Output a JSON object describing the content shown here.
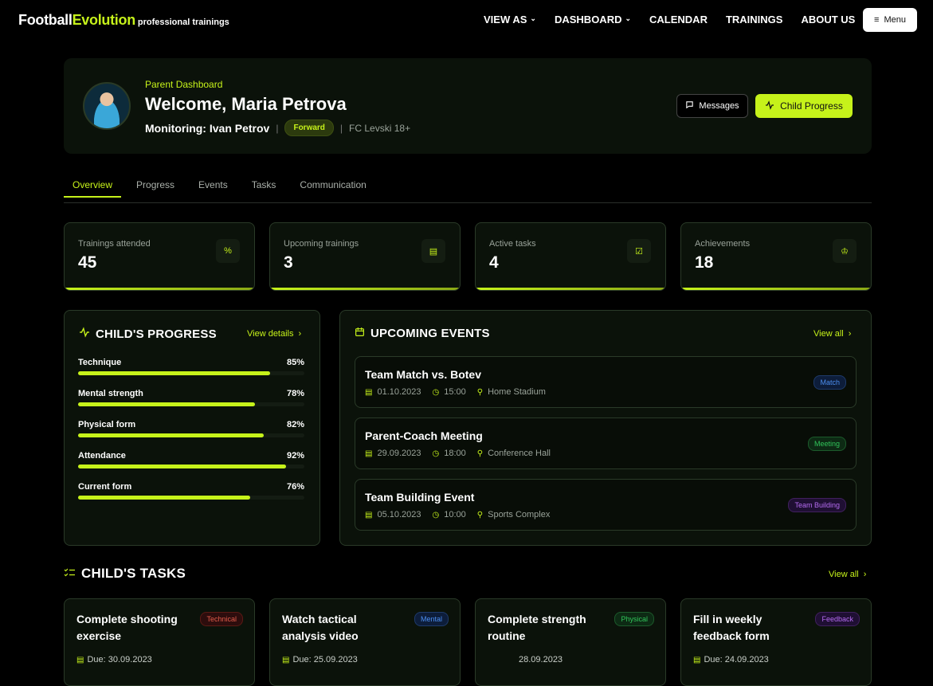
{
  "brand": {
    "part1": "Football",
    "part2": "Evolution",
    "tagline": "professional trainings"
  },
  "nav": {
    "items": [
      "VIEW AS",
      "DASHBOARD",
      "CALENDAR",
      "TRAININGS",
      "ABOUT US"
    ],
    "menu": "Menu"
  },
  "hero": {
    "subtitle": "Parent Dashboard",
    "title": "Welcome, Maria Petrova",
    "monitoring": "Monitoring: Ivan Petrov",
    "position": "Forward",
    "club": "FC Levski 18+",
    "messages_btn": "Messages",
    "progress_btn": "Child Progress"
  },
  "tabs": [
    "Overview",
    "Progress",
    "Events",
    "Tasks",
    "Communication"
  ],
  "stats": [
    {
      "label": "Trainings attended",
      "value": "45",
      "icon": "percent-icon"
    },
    {
      "label": "Upcoming trainings",
      "value": "3",
      "icon": "calendar-icon"
    },
    {
      "label": "Active tasks",
      "value": "4",
      "icon": "checkbox-icon"
    },
    {
      "label": "Achievements",
      "value": "18",
      "icon": "award-icon"
    }
  ],
  "progress": {
    "title": "CHILD'S PROGRESS",
    "link": "View details",
    "skills": [
      {
        "name": "Technique",
        "pct": "85%",
        "value": 85
      },
      {
        "name": "Mental strength",
        "pct": "78%",
        "value": 78
      },
      {
        "name": "Physical form",
        "pct": "82%",
        "value": 82
      },
      {
        "name": "Attendance",
        "pct": "92%",
        "value": 92
      },
      {
        "name": "Current form",
        "pct": "76%",
        "value": 76
      }
    ]
  },
  "events": {
    "title": "UPCOMING EVENTS",
    "link": "View all",
    "items": [
      {
        "title": "Team Match vs. Botev",
        "date": "01.10.2023",
        "time": "15:00",
        "place": "Home Stadium",
        "badge": "Match",
        "color": "blue"
      },
      {
        "title": "Parent-Coach Meeting",
        "date": "29.09.2023",
        "time": "18:00",
        "place": "Conference Hall",
        "badge": "Meeting",
        "color": "green"
      },
      {
        "title": "Team Building Event",
        "date": "05.10.2023",
        "time": "10:00",
        "place": "Sports Complex",
        "badge": "Team Building",
        "color": "purple"
      }
    ]
  },
  "tasks": {
    "title": "CHILD'S TASKS",
    "link": "View all",
    "items": [
      {
        "title": "Complete shooting exercise",
        "badge": "Technical",
        "color": "red",
        "due": "Due: 30.09.2023"
      },
      {
        "title": "Watch tactical analysis video",
        "badge": "Mental",
        "color": "blue",
        "due": "Due: 25.09.2023"
      },
      {
        "title": "Complete strength routine",
        "badge": "Physical",
        "color": "green",
        "due": "28.09.2023"
      },
      {
        "title": "Fill in weekly feedback form",
        "badge": "Feedback",
        "color": "purple",
        "due": "Due: 24.09.2023"
      }
    ]
  },
  "colors": {
    "accent": "#c6f21a",
    "background": "#000000",
    "card": "#0b120a"
  }
}
